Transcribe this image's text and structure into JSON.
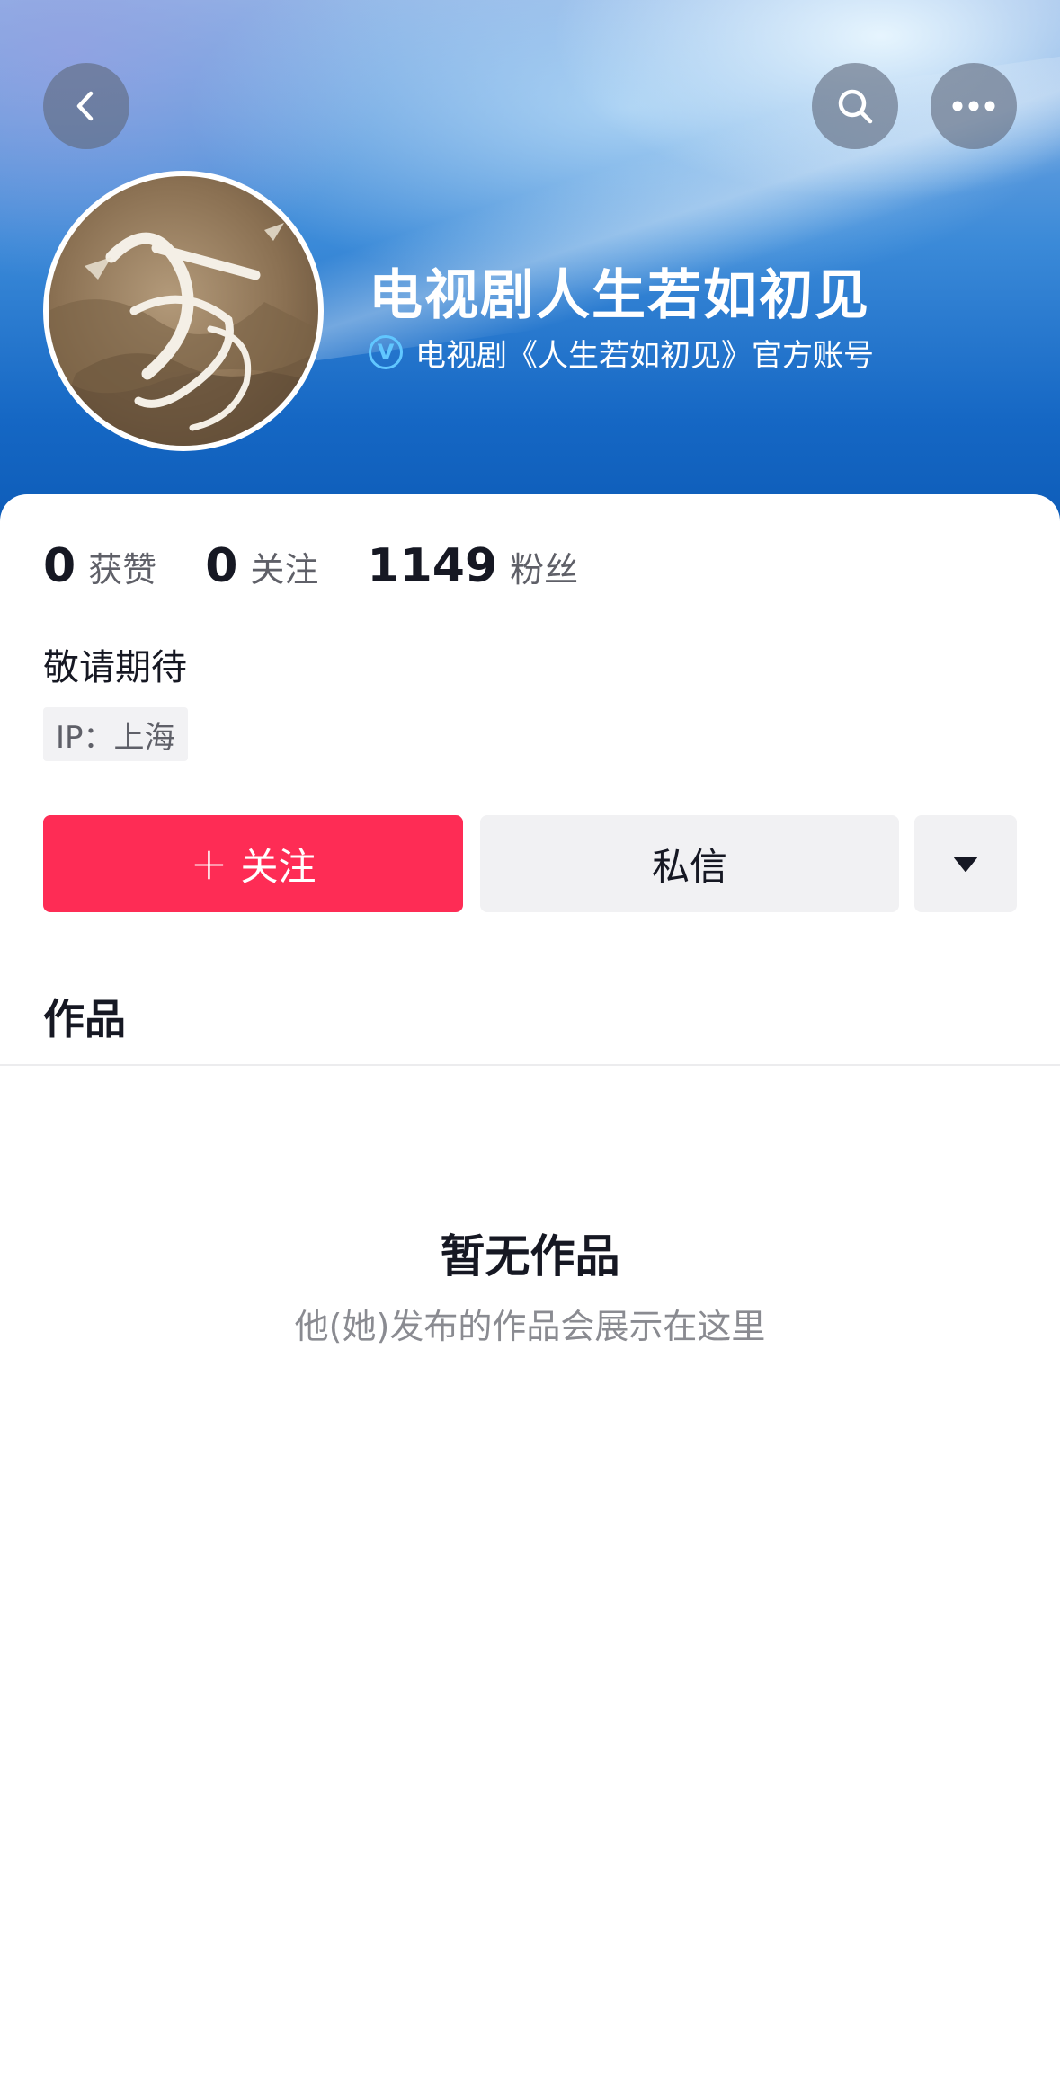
{
  "header": {
    "back_icon": "chevron-left-icon",
    "search_icon": "search-icon",
    "more_icon": "more-horizontal-icon"
  },
  "profile": {
    "name": "电视剧人生若如初见",
    "verification_badge": "V",
    "verification_text": "电视剧《人生若如初见》官方账号"
  },
  "stats": [
    {
      "value": "0",
      "label": "获赞"
    },
    {
      "value": "0",
      "label": "关注"
    },
    {
      "value": "1149",
      "label": "粉丝"
    }
  ],
  "bio": "敬请期待",
  "ip_location": "IP：上海",
  "actions": {
    "follow_plus": "+",
    "follow_label": "关注",
    "message_label": "私信",
    "dropdown_icon": "caret-down-icon"
  },
  "tabs": {
    "works_label": "作品"
  },
  "empty_state": {
    "title": "暂无作品",
    "subtitle": "他(她)发布的作品会展示在这里"
  },
  "colors": {
    "accent": "#fe2c55",
    "verify": "#61c7ff",
    "secondary_button": "#f1f1f3"
  }
}
